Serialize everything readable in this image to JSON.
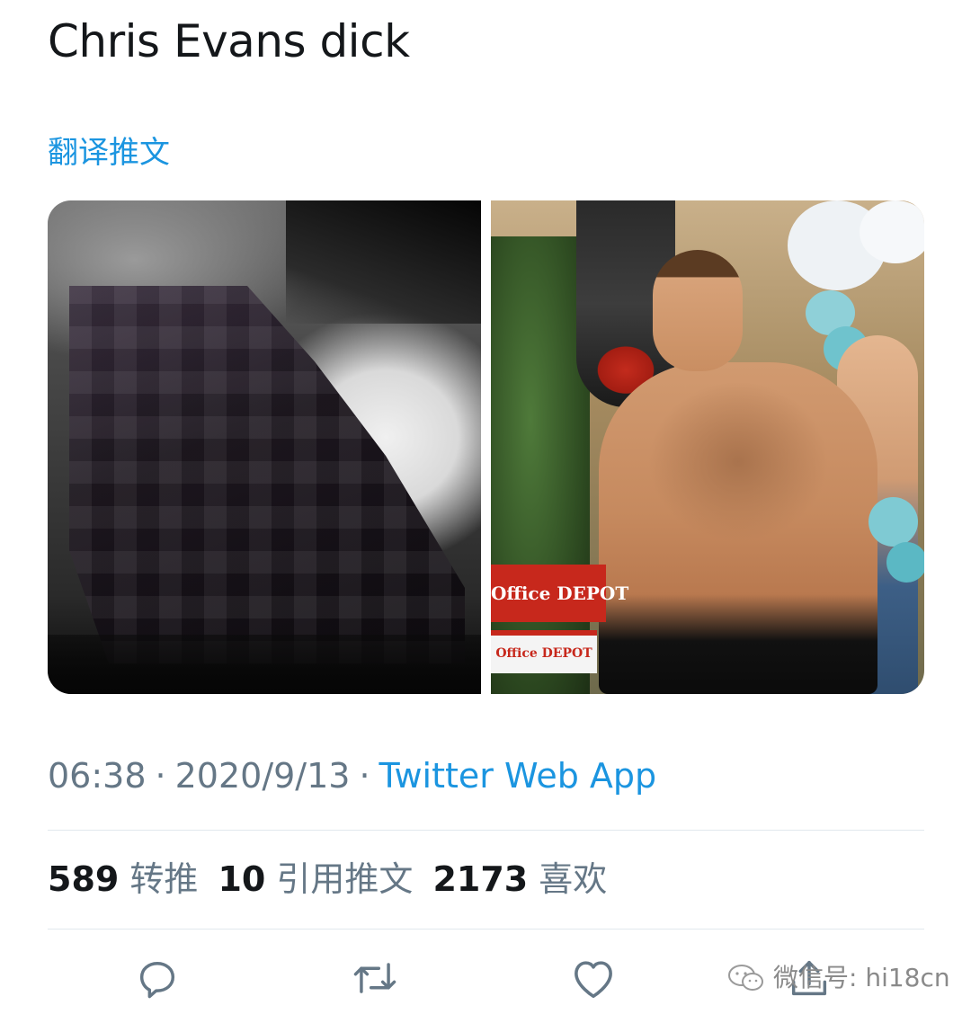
{
  "tweet": {
    "text": "Chris Evans dick",
    "translate_label": "翻译推文"
  },
  "media": {
    "count": 2,
    "right_image_sign_text": "Office DEPOT",
    "right_image_sign2_text": "Office DEPOT"
  },
  "meta": {
    "time": "06:38",
    "separator": "·",
    "date": "2020/9/13",
    "source": "Twitter Web App"
  },
  "stats": {
    "retweets_count": "589",
    "retweets_label": "转推",
    "quotes_count": "10",
    "quotes_label": "引用推文",
    "likes_count": "2173",
    "likes_label": "喜欢"
  },
  "actions": {
    "reply_icon": "reply-icon",
    "retweet_icon": "retweet-icon",
    "like_icon": "heart-icon",
    "share_icon": "share-icon"
  },
  "watermark": {
    "text": "微信号: hi18cn"
  },
  "colors": {
    "link": "#1b95e0",
    "secondary_text": "#657786",
    "primary_text": "#14171a",
    "divider": "#e1e8ed"
  }
}
